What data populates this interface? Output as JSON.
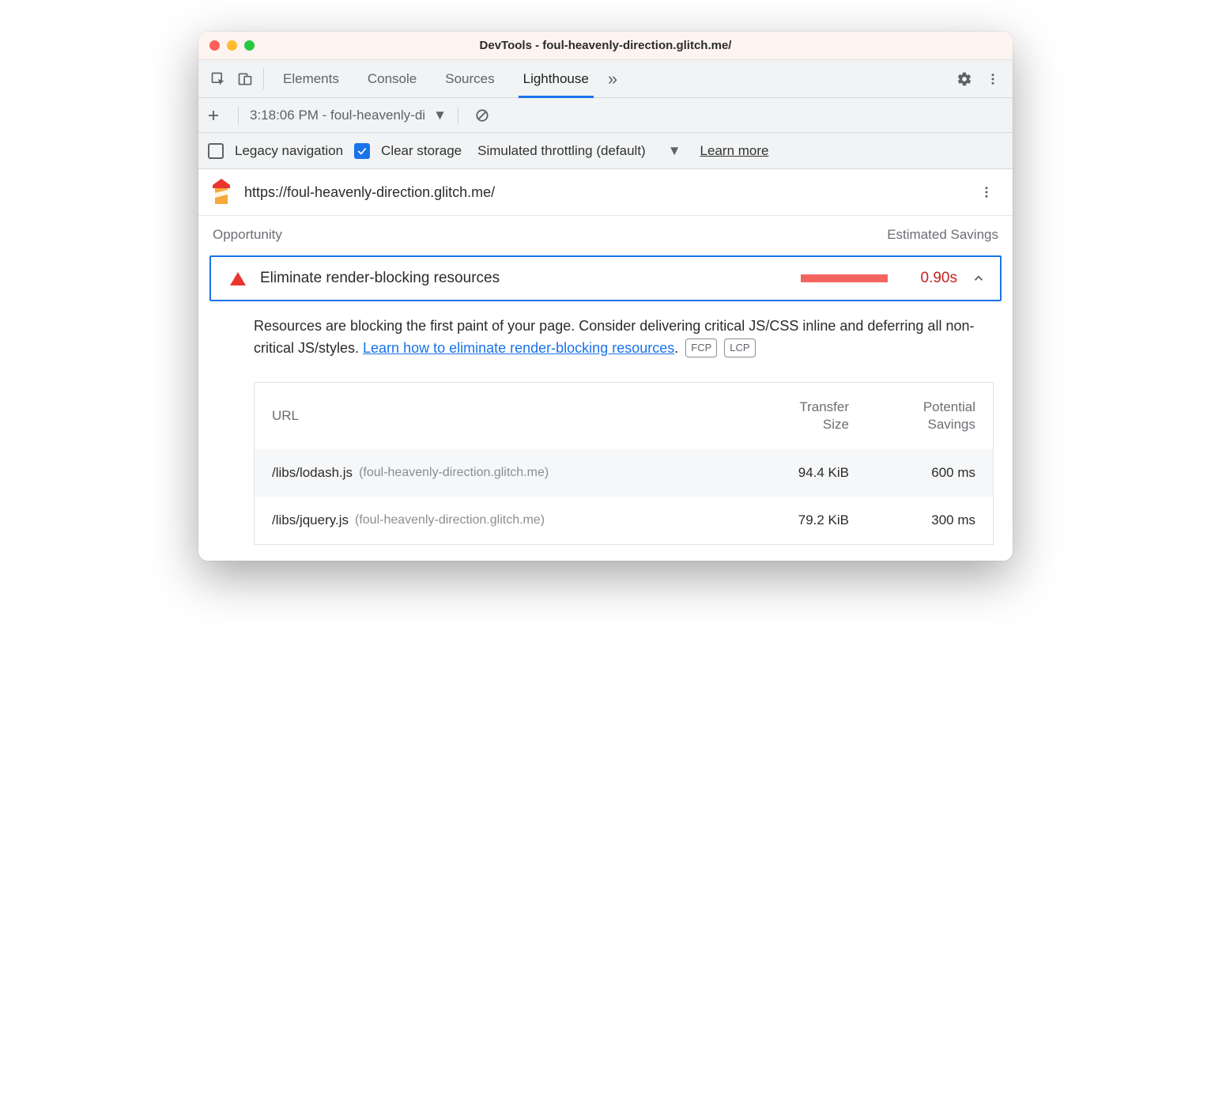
{
  "window": {
    "title": "DevTools - foul-heavenly-direction.glitch.me/"
  },
  "tabs": {
    "items": [
      "Elements",
      "Console",
      "Sources",
      "Lighthouse"
    ],
    "active": "Lighthouse"
  },
  "subbar": {
    "run_label": "3:18:06 PM - foul-heavenly-di"
  },
  "options": {
    "legacy_label": "Legacy navigation",
    "legacy_checked": false,
    "clear_label": "Clear storage",
    "clear_checked": true,
    "throttle_label": "Simulated throttling (default)",
    "learn_more": "Learn more"
  },
  "report": {
    "url": "https://foul-heavenly-direction.glitch.me/",
    "section_left": "Opportunity",
    "section_right": "Estimated Savings",
    "opportunity": {
      "title": "Eliminate render-blocking resources",
      "savings": "0.90s",
      "desc_pre": "Resources are blocking the first paint of your page. Consider delivering critical JS/CSS inline and deferring all non-critical JS/styles. ",
      "desc_link": "Learn how to eliminate render-blocking resources",
      "desc_post": ".",
      "badges": [
        "FCP",
        "LCP"
      ],
      "table": {
        "head_url": "URL",
        "head_size": "Transfer Size",
        "head_save": "Potential Savings",
        "rows": [
          {
            "path": "/libs/lodash.js",
            "host": "(foul-heavenly-direction.glitch.me)",
            "size": "94.4 KiB",
            "save": "600 ms"
          },
          {
            "path": "/libs/jquery.js",
            "host": "(foul-heavenly-direction.glitch.me)",
            "size": "79.2 KiB",
            "save": "300 ms"
          }
        ]
      }
    }
  }
}
